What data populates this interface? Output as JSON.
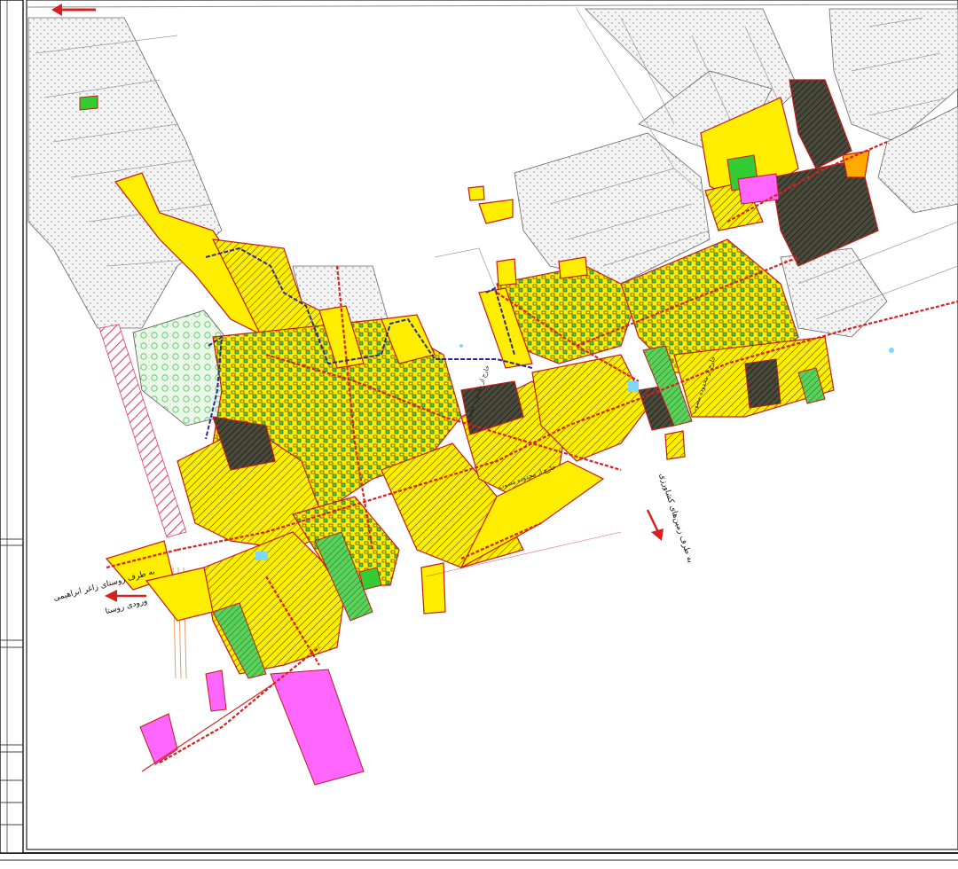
{
  "map": {
    "labels": {
      "road_to_villages": "به طرف روستای زاغر ابراهیمی",
      "village_entrance": "ورودی روستا",
      "road_to_farms": "به طرف زمین‌های کشاورزی",
      "outside_boundary_north": "خارج از محدوده مصوب",
      "outside_boundary_center": "خارج از محدوده مصوب",
      "outside_boundary_east": "خارج از محدوده مصوب"
    },
    "colors": {
      "residential": "#ffff00",
      "residential_hatch": "#2b2b00",
      "green_space": "#33cc33",
      "green_light": "#7cdc6a",
      "public_facility": "#ff66ff",
      "road_boundary": "#d82020",
      "old_fabric": "#2a2a7a",
      "agricultural": "#9a9a9a",
      "orchard": "#8fd88f",
      "dark_hatch": "#2b2b2b"
    },
    "legend_panel": {
      "icon": "map-legend-frame"
    }
  }
}
